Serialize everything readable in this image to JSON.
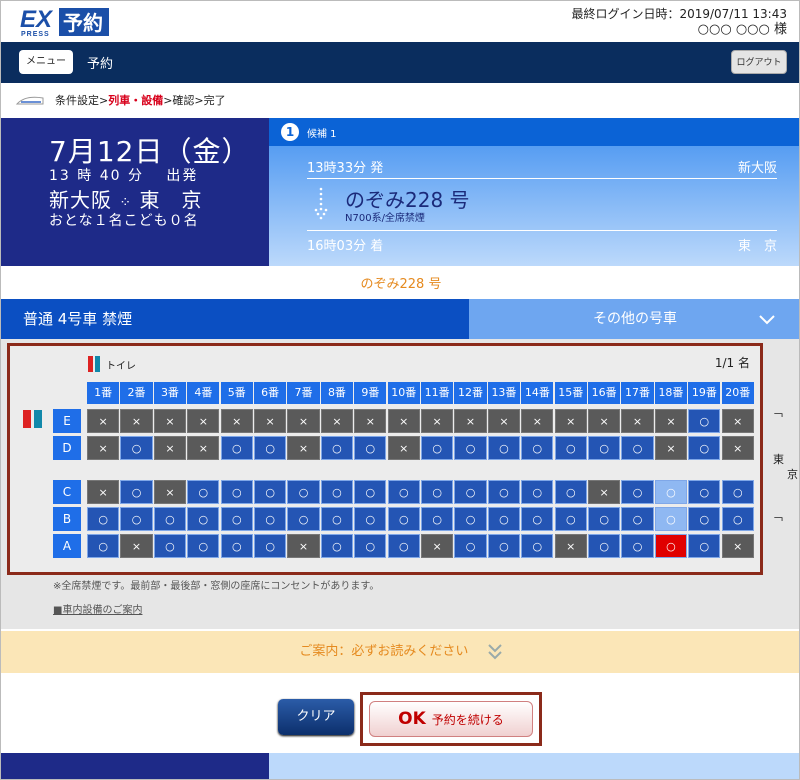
{
  "header": {
    "logo_ex": "EX",
    "logo_press": "PRESS",
    "logo_yoyaku": "予約",
    "last_login": "最終ログイン日時：2019/07/11 13:43",
    "user": "○○○ ○○○ 様"
  },
  "nav": {
    "menu": "メニュー",
    "title": "予約",
    "logout": "ログアウト"
  },
  "breadcrumb": {
    "s1": "条件設定>",
    "s2": "列車・設備",
    "s3": ">確認>完了"
  },
  "date_panel": {
    "date": "7月12日（金）",
    "time": "13 時 40 分　 出発",
    "route_from": "新大阪",
    "route_sep": "⁘",
    "route_to": "東　京",
    "pax": "おとな１名こども０名"
  },
  "candidate": {
    "num": "1",
    "label": "候補 1",
    "dep_time": "13時33分 発",
    "dep_station": "新大阪",
    "train_name": "のぞみ228 号",
    "train_car": "N700系/全席禁煙",
    "arr_time": "16時03分 着",
    "arr_station": "東　京"
  },
  "train_caption": "のぞみ228 号",
  "car": {
    "current": "普通 4号車 禁煙",
    "other": "その他の号車"
  },
  "seat_map": {
    "toilet": "トイレ",
    "count": "1/1 名",
    "columns": [
      "1番",
      "2番",
      "3番",
      "4番",
      "5番",
      "6番",
      "7番",
      "8番",
      "9番",
      "10番",
      "11番",
      "12番",
      "13番",
      "14番",
      "15番",
      "16番",
      "17番",
      "18番",
      "19番",
      "20番"
    ],
    "rows": [
      {
        "label": "E",
        "seats": [
          "×",
          "×",
          "×",
          "×",
          "×",
          "×",
          "×",
          "×",
          "×",
          "×",
          "×",
          "×",
          "×",
          "×",
          "×",
          "×",
          "×",
          "×",
          "○",
          "×"
        ]
      },
      {
        "label": "D",
        "seats": [
          "×",
          "○",
          "×",
          "×",
          "○",
          "○",
          "×",
          "○",
          "○",
          "×",
          "○",
          "○",
          "○",
          "○",
          "○",
          "○",
          "○",
          "×",
          "○",
          "×"
        ]
      },
      {
        "label": "C",
        "seats": [
          "×",
          "○",
          "×",
          "○",
          "○",
          "○",
          "○",
          "○",
          "○",
          "○",
          "○",
          "○",
          "○",
          "○",
          "○",
          "×",
          "○",
          "○",
          "○",
          "○"
        ]
      },
      {
        "label": "B",
        "seats": [
          "○",
          "○",
          "○",
          "○",
          "○",
          "○",
          "○",
          "○",
          "○",
          "○",
          "○",
          "○",
          "○",
          "○",
          "○",
          "○",
          "○",
          "○",
          "○",
          "○"
        ]
      },
      {
        "label": "A",
        "seats": [
          "○",
          "×",
          "○",
          "○",
          "○",
          "○",
          "×",
          "○",
          "○",
          "○",
          "×",
          "○",
          "○",
          "○",
          "×",
          "○",
          "○",
          "○",
          "○",
          "×"
        ]
      }
    ],
    "side_right": [
      "東",
      "京"
    ],
    "selected": {
      "row": "A",
      "col": "18番"
    }
  },
  "note": "※全席禁煙です。最前部・最後部・窓側の座席にコンセントがあります。",
  "facility_link": "■車内設備のご案内",
  "guide": "ご案内：必ずお読みください",
  "buttons": {
    "clear": "クリア",
    "ok_prefix": "OK",
    "ok_label": "予約を続ける"
  },
  "colors": {
    "navy": "#0a2d5e",
    "accent_blue": "#1f6ee8",
    "selected_red": "#e00000",
    "orange": "#e58a1f"
  }
}
